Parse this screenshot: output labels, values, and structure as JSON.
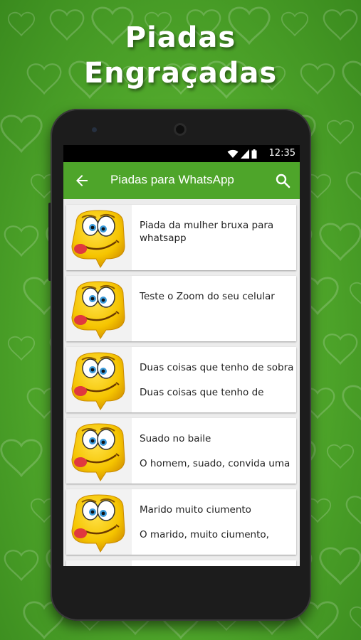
{
  "headline": {
    "line1": "Piadas",
    "line2": "Engraçadas"
  },
  "statusbar": {
    "time": "12:35",
    "icons": [
      "wifi-icon",
      "signal-icon",
      "battery-icon"
    ]
  },
  "appbar": {
    "title": "Piadas para WhatsApp",
    "back_icon": "arrow-back-icon",
    "search_icon": "search-icon",
    "color": "#4ea52a"
  },
  "jokes": [
    {
      "title": "Piada da mulher bruxa para whatsapp",
      "preview": ""
    },
    {
      "title": "Teste o Zoom do seu celular",
      "preview": ""
    },
    {
      "title": "Duas coisas que tenho de sobra",
      "preview": "Duas coisas que tenho de"
    },
    {
      "title": "Suado no baile",
      "preview": "O homem, suado, convida uma"
    },
    {
      "title": "Marido muito ciumento",
      "preview": "O marido, muito ciumento,"
    }
  ],
  "colors": {
    "background": "#4ea52a",
    "emoji": "#f5c400"
  }
}
